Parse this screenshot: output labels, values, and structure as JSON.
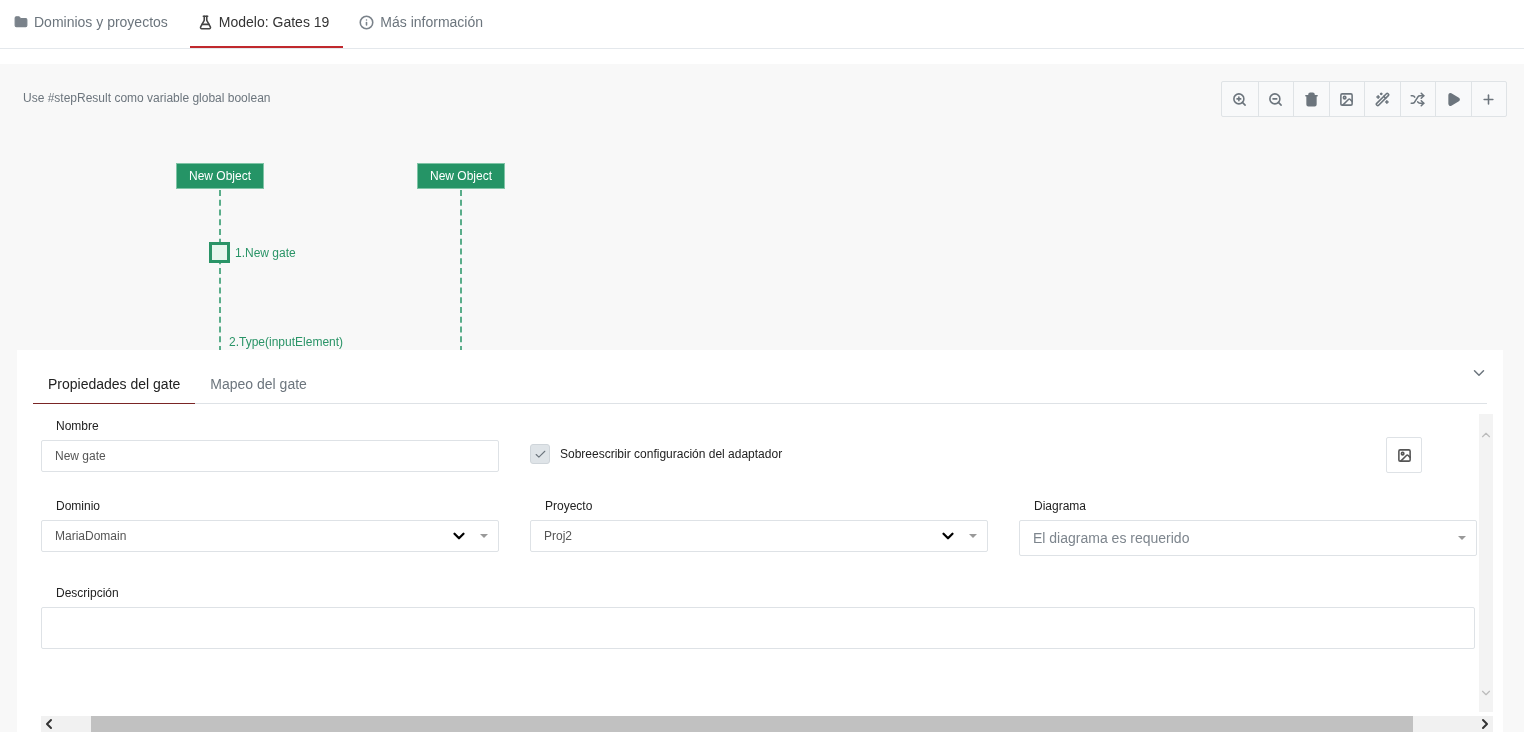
{
  "tabs": [
    {
      "label": "Dominios y proyectos",
      "selected": false
    },
    {
      "label": "Modelo: Gates 19",
      "selected": true
    },
    {
      "label": "Más información",
      "selected": false
    }
  ],
  "canvas": {
    "hint": "Use #stepResult como variable global boolean",
    "objects": [
      {
        "label": "New Object"
      },
      {
        "label": "New Object"
      }
    ],
    "messages": [
      {
        "label": "1.New gate",
        "kind": "self"
      },
      {
        "label": "2.Type(inputElement)",
        "kind": "call"
      }
    ]
  },
  "panel": {
    "tabs": [
      {
        "label": "Propiedades del gate",
        "selected": true
      },
      {
        "label": "Mapeo del gate",
        "selected": false
      }
    ],
    "nombre": {
      "label": "Nombre",
      "value": "New gate"
    },
    "override": {
      "label": "Sobreescribir configuración del adaptador",
      "checked": true
    },
    "selects": [
      {
        "label": "Dominio",
        "value": "MariaDomain",
        "kind": "filled"
      },
      {
        "label": "Proyecto",
        "value": "Proj2",
        "kind": "filled"
      },
      {
        "label": "Diagrama",
        "placeholder": "El diagrama es requerido",
        "kind": "empty"
      }
    ],
    "descripcion": {
      "label": "Descripción"
    }
  }
}
